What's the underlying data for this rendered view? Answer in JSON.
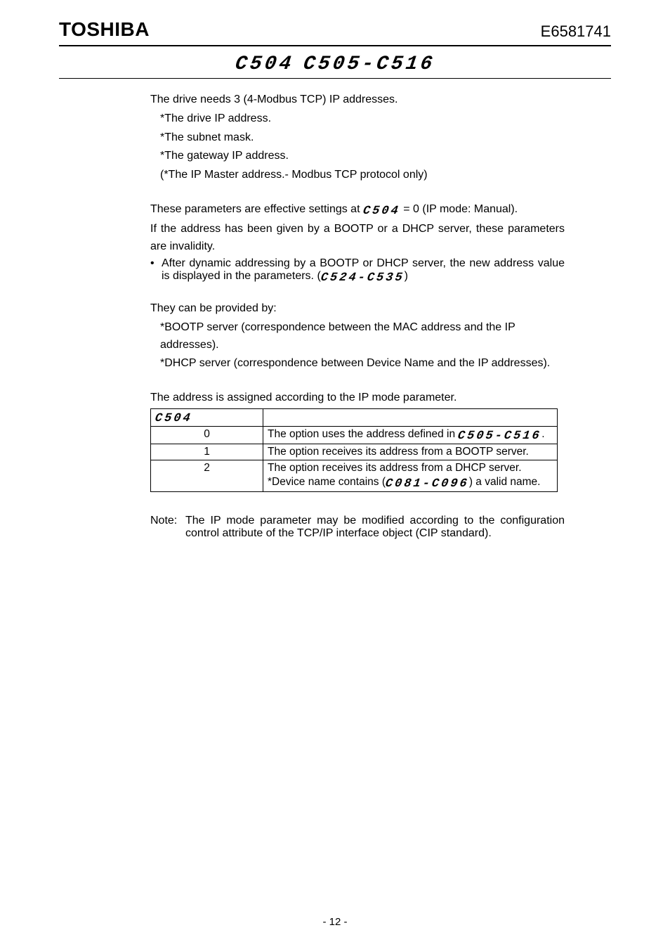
{
  "header": {
    "brand": "TOSHIBA",
    "doc_number": "E6581741"
  },
  "title": {
    "seg_a": "C504",
    "seg_b": "C505-C516"
  },
  "intro": "The drive needs 3 (4-Modbus TCP) IP addresses.",
  "intro_items": [
    "*The drive IP address.",
    "*The subnet mask.",
    "*The gateway IP address.",
    "(*The IP Master address.- Modbus TCP protocol only)"
  ],
  "effective": {
    "pre": "These parameters are effective settings at ",
    "seg": "C504",
    "post": " = 0 (IP mode: Manual)."
  },
  "invalid_line": "If the address has been given by a BOOTP or a DHCP server, these parameters are invalidity.",
  "bullet": {
    "pre": "After dynamic addressing by a BOOTP or DHCP server, the new address value is displayed in the parameters. (",
    "seg": "C524-C535",
    "post": ")"
  },
  "provided_intro": "They can be provided by:",
  "provided_items": [
    "*BOOTP server (correspondence between the MAC address and the IP addresses).",
    "*DHCP server (correspondence between Device Name and the IP addresses)."
  ],
  "table_intro": "The address is assigned according to the IP mode parameter.",
  "table": {
    "header_param": "C504",
    "rows": [
      {
        "val": "0",
        "pre": "The option uses the address defined in ",
        "seg": "C505-C516",
        "post": "."
      },
      {
        "val": "1",
        "pre": "The option receives its address from a BOOTP server.",
        "seg": "",
        "post": ""
      },
      {
        "val": "2",
        "pre": "The option receives its address from a DHCP server.",
        "seg": "",
        "post": "",
        "extra_pre": "*Device name contains (",
        "extra_seg": "C081-C096",
        "extra_post": ") a valid name."
      }
    ]
  },
  "note": {
    "label": "Note:",
    "body": "The IP mode parameter may be modified according to the configuration control attribute of the TCP/IP interface object (CIP standard)."
  },
  "footer": "- 12 -"
}
